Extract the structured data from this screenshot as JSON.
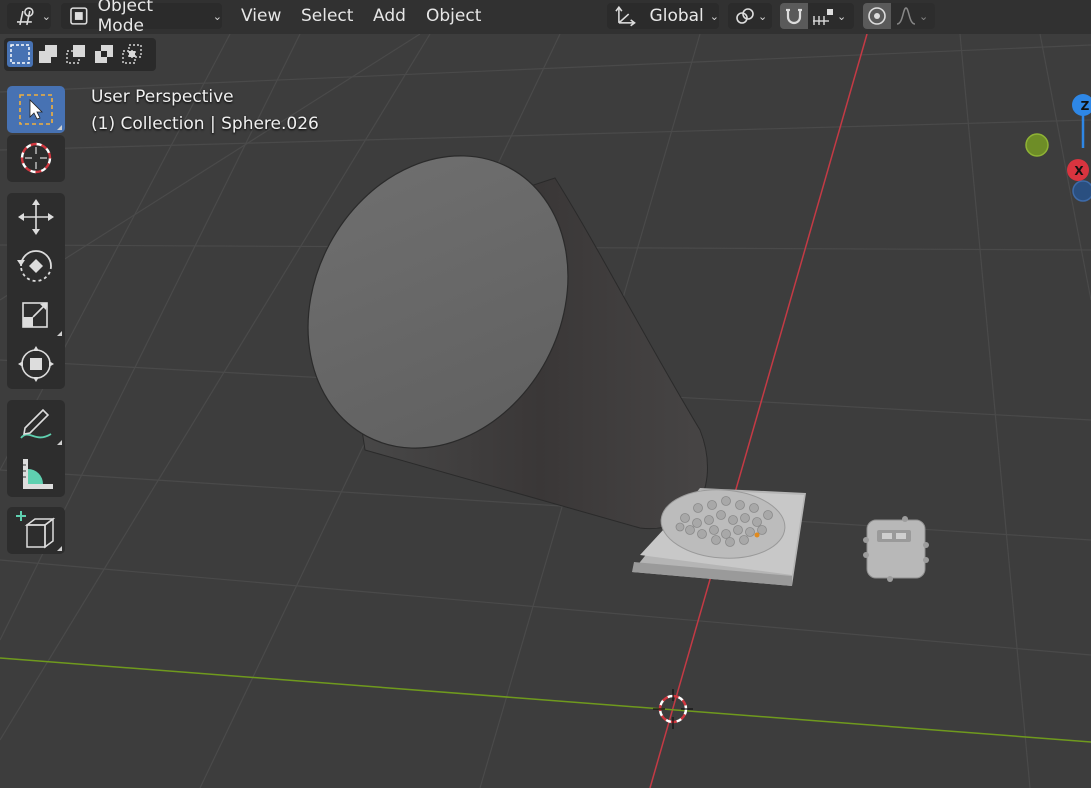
{
  "header": {
    "mode_label": "Object Mode",
    "menus": [
      "View",
      "Select",
      "Add",
      "Object"
    ],
    "orientation_label": "Global"
  },
  "viewport": {
    "perspective_label": "User Perspective",
    "object_info": "(1) Collection | Sphere.026"
  },
  "gizmo": {
    "z_label": "Z",
    "x_label": "X"
  },
  "colors": {
    "active_tool": "#4772b3",
    "x_axis": "#d8343f",
    "y_axis": "#7ea61e",
    "z_axis": "#2e87e6",
    "background": "#3d3d3d"
  }
}
